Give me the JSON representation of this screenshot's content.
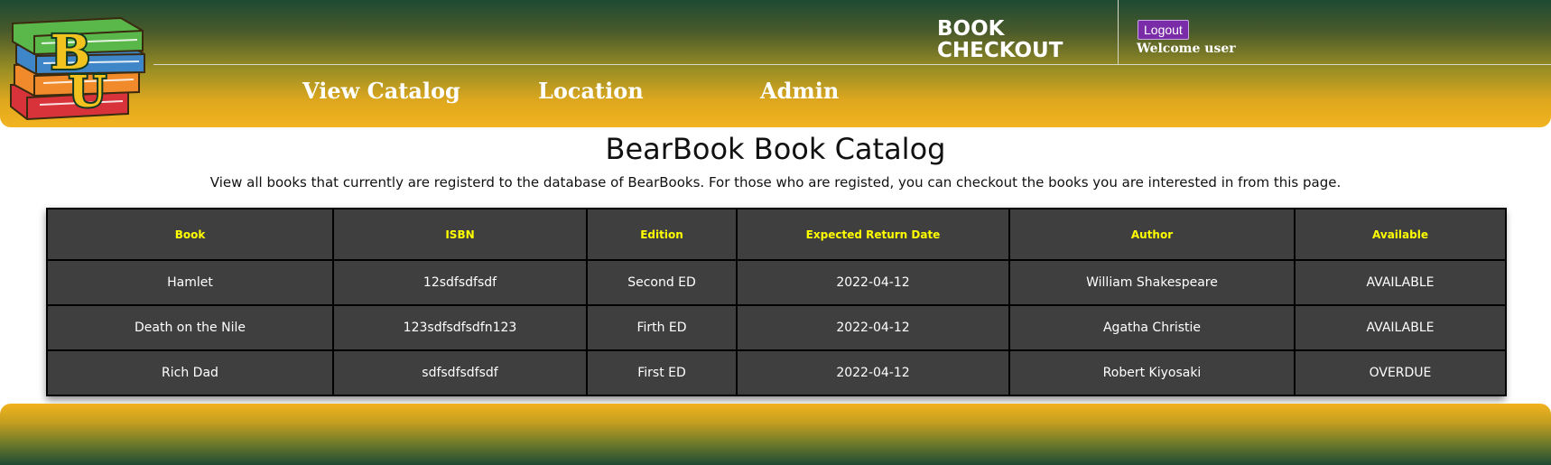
{
  "header": {
    "brand_line1": "BOOK",
    "brand_line2": "CHECKOUT",
    "logout_label": "Logout",
    "welcome_text": "Welcome user",
    "nav": [
      {
        "label": "View Catalog"
      },
      {
        "label": "Location"
      },
      {
        "label": "Admin"
      }
    ],
    "logo_letters": "BU"
  },
  "main": {
    "title": "BearBook Book Catalog",
    "description": "View all books that currently are registerd to the database of BearBooks. For those who are registed, you can checkout the books you are interested in from this page."
  },
  "table": {
    "columns": [
      "Book",
      "ISBN",
      "Edition",
      "Expected Return Date",
      "Author",
      "Available"
    ],
    "rows": [
      [
        "Hamlet",
        "12sdfsdfsdf",
        "Second ED",
        "2022-04-12",
        "William Shakespeare",
        "AVAILABLE"
      ],
      [
        "Death on the Nile",
        "123sdfsdfsdfn123",
        "Firth ED",
        "2022-04-12",
        "Agatha Christie",
        "AVAILABLE"
      ],
      [
        "Rich Dad",
        "sdfsdfsdfsdf",
        "First ED",
        "2022-04-12",
        "Robert Kiyosaki",
        "OVERDUE"
      ]
    ]
  },
  "colors": {
    "header_top": "#1e4a33",
    "header_bottom": "#f2b31f",
    "table_bg": "#3f3f3f",
    "table_header_text": "#ffff00",
    "logout_bg": "#7a2ba8"
  }
}
